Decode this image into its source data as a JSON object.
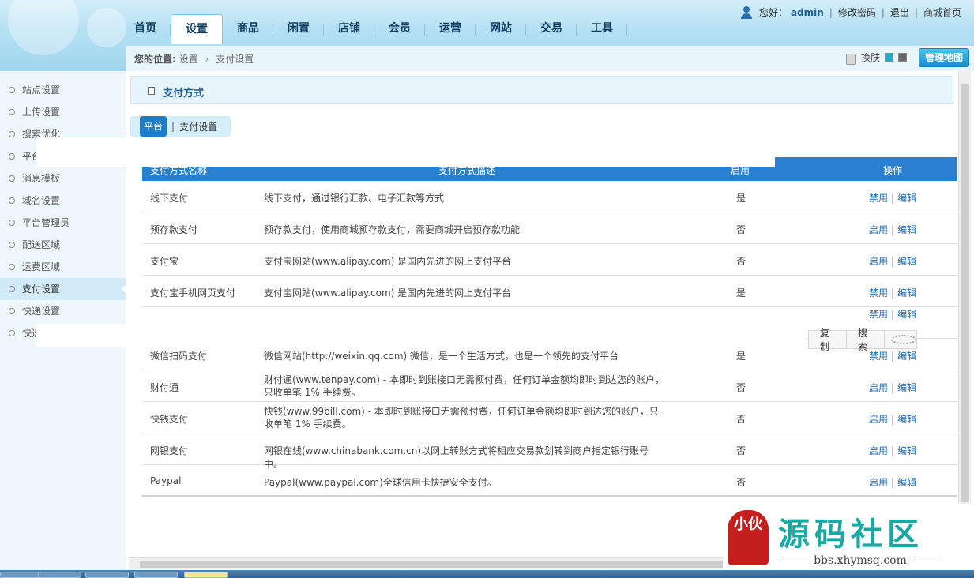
{
  "header": {
    "greeting": "您好：",
    "username": "admin",
    "change_password": "修改密码",
    "logout": "退出",
    "mall_home": "商城首页",
    "nav_tabs": [
      "首页",
      "设置",
      "商品",
      "闲置",
      "店铺",
      "会员",
      "运营",
      "网站",
      "交易",
      "工具"
    ],
    "active_tab": "设置"
  },
  "breadcrumb": {
    "label": "您的位置:",
    "level1": "设置",
    "arrow": "›",
    "level2": "支付设置"
  },
  "skin": {
    "label": "换肤",
    "colors": [
      "#27a6d6",
      "#666666"
    ]
  },
  "map_button": "管理地图",
  "sidebar": {
    "items": [
      "站点设置",
      "上传设置",
      "搜索优化",
      "平台",
      "消息模板",
      "域名设置",
      "平台管理员",
      "配送区域",
      "运费区域",
      "支付设置",
      "快递设置",
      "快递"
    ],
    "active_index": 9
  },
  "panel": {
    "title": "支付方式"
  },
  "subtabs": {
    "active": "平台",
    "divider": "|",
    "link": "支付设置"
  },
  "table": {
    "headers": [
      "支付方式名称",
      "支付方式描述",
      "启用",
      "操作"
    ],
    "rows": [
      {
        "name": "线下支付",
        "desc": "线下支付，通过银行汇款、电子汇款等方式",
        "enabled": "是",
        "action1": "禁用",
        "action2": "编辑"
      },
      {
        "name": "预存款支付",
        "desc": "预存款支付，使用商城预存款支付，需要商城开启预存款功能",
        "enabled": "否",
        "action1": "启用",
        "action2": "编辑"
      },
      {
        "name": "支付宝",
        "desc": "支付宝网站(www.alipay.com) 是国内先进的网上支付平台",
        "enabled": "否",
        "action1": "启用",
        "action2": "编辑"
      },
      {
        "name": "支付宝手机网页支付",
        "desc": "支付宝网站(www.alipay.com) 是国内先进的网上支付平台",
        "enabled": "是",
        "action1": "禁用",
        "action2": "编辑"
      },
      {
        "name": "",
        "desc": "",
        "enabled": "",
        "action1": "禁用",
        "action2": "编辑"
      },
      {
        "name": "微信扫码支付",
        "desc": "微信网站(http://weixin.qq.com) 微信，是一个生活方式，也是一个领先的支付平台",
        "enabled": "是",
        "action1": "禁用",
        "action2": "编辑"
      },
      {
        "name": "财付通",
        "desc": "财付通(www.tenpay.com) - 本即时到账接口无需预付费，任何订单金额均即时到达您的账户，只收单笔 1% 手续费。",
        "enabled": "否",
        "action1": "启用",
        "action2": "编辑"
      },
      {
        "name": "快钱支付",
        "desc": "快钱(www.99bill.com) - 本即时到账接口无需预付费，任何订单金额均即时到达您的账户，只收单笔 1% 手续费。",
        "enabled": "否",
        "action1": "启用",
        "action2": "编辑"
      },
      {
        "name": "网银支付",
        "desc": "网银在线(www.chinabank.com.cn)以网上转账方式将相应交易款划转到商户指定银行账号中。",
        "enabled": "否",
        "action1": "启用",
        "action2": "编辑"
      },
      {
        "name": "Paypal",
        "desc": "Paypal(www.paypal.com)全球信用卡快捷安全支付。",
        "enabled": "否",
        "action1": "启用",
        "action2": "编辑"
      }
    ]
  },
  "context_bar": {
    "copy": "复制",
    "search": "搜索"
  },
  "watermark": {
    "seal": "小伙",
    "brand": "源码社区",
    "url": "bbs.xhymsq.com"
  }
}
